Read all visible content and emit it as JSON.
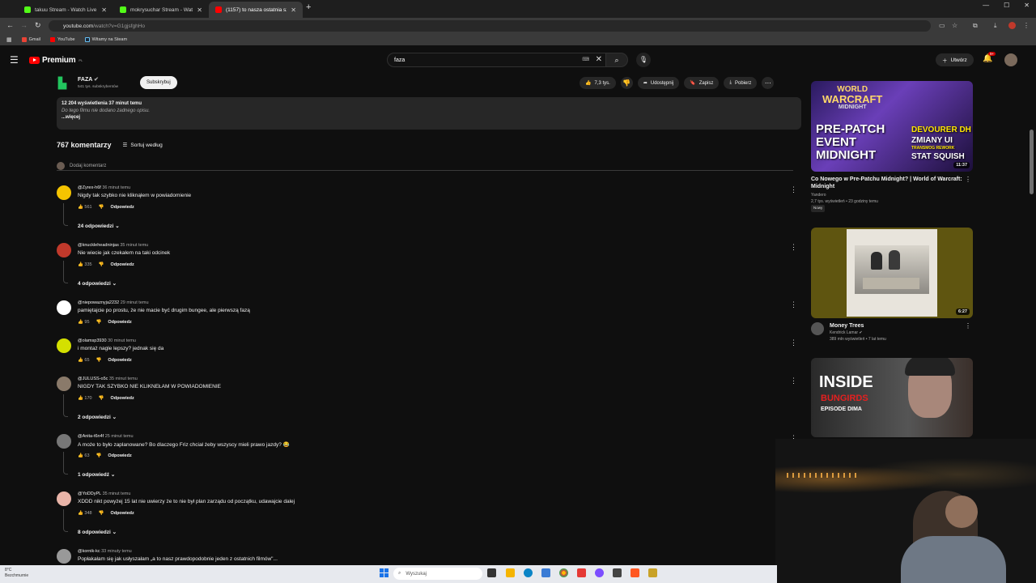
{
  "browser": {
    "tabs": [
      {
        "title": "takuu Stream - Watch Live on Kick",
        "color": "#53fc18"
      },
      {
        "title": "mokrysuchar Stream - Watch Live on Kick",
        "color": "#53fc18"
      },
      {
        "title": "(1157) to nasza ostatnia szansa",
        "color": "#ff0000"
      }
    ],
    "url_host": "youtube.com",
    "url_path": "/watch?v=G1gjsfghHo",
    "bookmarks": [
      "Gmail",
      "YouTube",
      "Witamy na Steam"
    ]
  },
  "yt": {
    "logo": "Premium",
    "logo_region": "PL",
    "search_value": "faza",
    "create_label": "Utwórz",
    "notif_count": "9+"
  },
  "channel": {
    "name": "FAZA",
    "subs": "541 tys. subskrybentów",
    "subscribe_label": "Subskrybuj"
  },
  "actions": {
    "likes": "7,3 tys.",
    "share": "Udostępnij",
    "save": "Zapisz",
    "download": "Pobierz"
  },
  "description": {
    "stats": "12 204 wyświetlenia  37 minut temu",
    "nodesc": "Do tego filmu nie dodano żadnego opisu.",
    "more": "...więcej"
  },
  "comments_header": {
    "count": "767 komentarzy",
    "sort": "Sortuj według",
    "add": "Dodaj komentarz"
  },
  "comments": [
    {
      "user": "@Zyrex-h6f",
      "time": "36 minut temu",
      "text": "Nigdy tak szybko nie kliknąłem w powiadomienie",
      "likes": "561",
      "reply": "Odpowiedz",
      "replies": "24 odpowiedzi",
      "avatar_color": "#f5c400"
    },
    {
      "user": "@knuckleheadninjas",
      "time": "35 minut temu",
      "text": "Nie wiecie jak czekałem na taki odcinek",
      "likes": "335",
      "reply": "Odpowiedz",
      "replies": "4 odpowiedzi",
      "avatar_color": "#c0392b"
    },
    {
      "user": "@niepowaznyja2232",
      "time": "29 minut temu",
      "text": "pamiętajcie po prostu, że nie macie być drugim bungee, ale pierwszą fazą",
      "likes": "95",
      "reply": "Odpowiedz",
      "replies": "",
      "avatar_color": "#ffffff"
    },
    {
      "user": "@olamsp3930",
      "time": "30 minut temu",
      "text": "i montaż nagle lepszy? jednak się da",
      "likes": "65",
      "reply": "Odpowiedz",
      "replies": "",
      "avatar_color": "#d4e000"
    },
    {
      "user": "@JULUSS-o5c",
      "time": "35 minut temu",
      "text": "NIGDY TAK SZYBKO NIE KLIKNEŁAM W POWIADOMIENIE",
      "likes": "170",
      "reply": "Odpowiedz",
      "replies": "2 odpowiedzi",
      "avatar_color": "#8a7a6a"
    },
    {
      "user": "@Anita-t6n4f",
      "time": "25 minut temu",
      "text": "A może to było zaplanowane? Bo dlaczego Friz chciał żeby wszyscy mieli prawo jazdy? 😂",
      "likes": "63",
      "reply": "Odpowiedz",
      "replies": "1 odpowiedź",
      "avatar_color": "#777777"
    },
    {
      "user": "@YoDDyPL",
      "time": "35 minut temu",
      "text": "XDDD nikt powyżej 15 lat nie uwierzy że to nie był plan zarządu od początku, udawajcie dalej",
      "likes": "348",
      "reply": "Odpowiedz",
      "replies": "8 odpowiedzi",
      "avatar_color": "#e8b4a8"
    },
    {
      "user": "@kornik-kc",
      "time": "33 minuty temu",
      "text": "Popłakałam się jak usłyszałam „a to nasz prawdopodobnie jeden z ostatnich filmów\"...",
      "likes": "",
      "reply": "",
      "replies": "",
      "avatar_color": "#999999"
    }
  ],
  "recommended": [
    {
      "title": "Co Nowego w Pre-Patchu Midnight? | World of Warcraft: Midnight",
      "channel": "Yandero",
      "meta": "2,7 tys. wyświetleń • 23 godziny temu",
      "badge": "Nowy",
      "duration": "11:37",
      "thumb_lines": [
        "WORLD",
        "WARCRAFT",
        "MIDNIGHT",
        "PRE-PATCH",
        "EVENT",
        "MIDNIGHT",
        "DEVOURER DH",
        "ZMIANY UI",
        "TRANSMOG REWORK",
        "STAT SQUISH"
      ]
    },
    {
      "title": "Money Trees",
      "channel": "Kendrick Lamar",
      "meta": "389 mln wyświetleń • 7 lat temu",
      "badge": "",
      "duration": "6:27",
      "thumb_lines": []
    },
    {
      "title": "",
      "channel": "",
      "meta": "",
      "badge": "",
      "duration": "",
      "thumb_lines": [
        "INSIDE",
        "BUNGIRDS",
        "EPISODE DIMA"
      ]
    }
  ],
  "taskbar": {
    "weather_temp": "8°C",
    "weather_desc": "Bezchmurnie",
    "search_placeholder": "Wyszukaj"
  }
}
